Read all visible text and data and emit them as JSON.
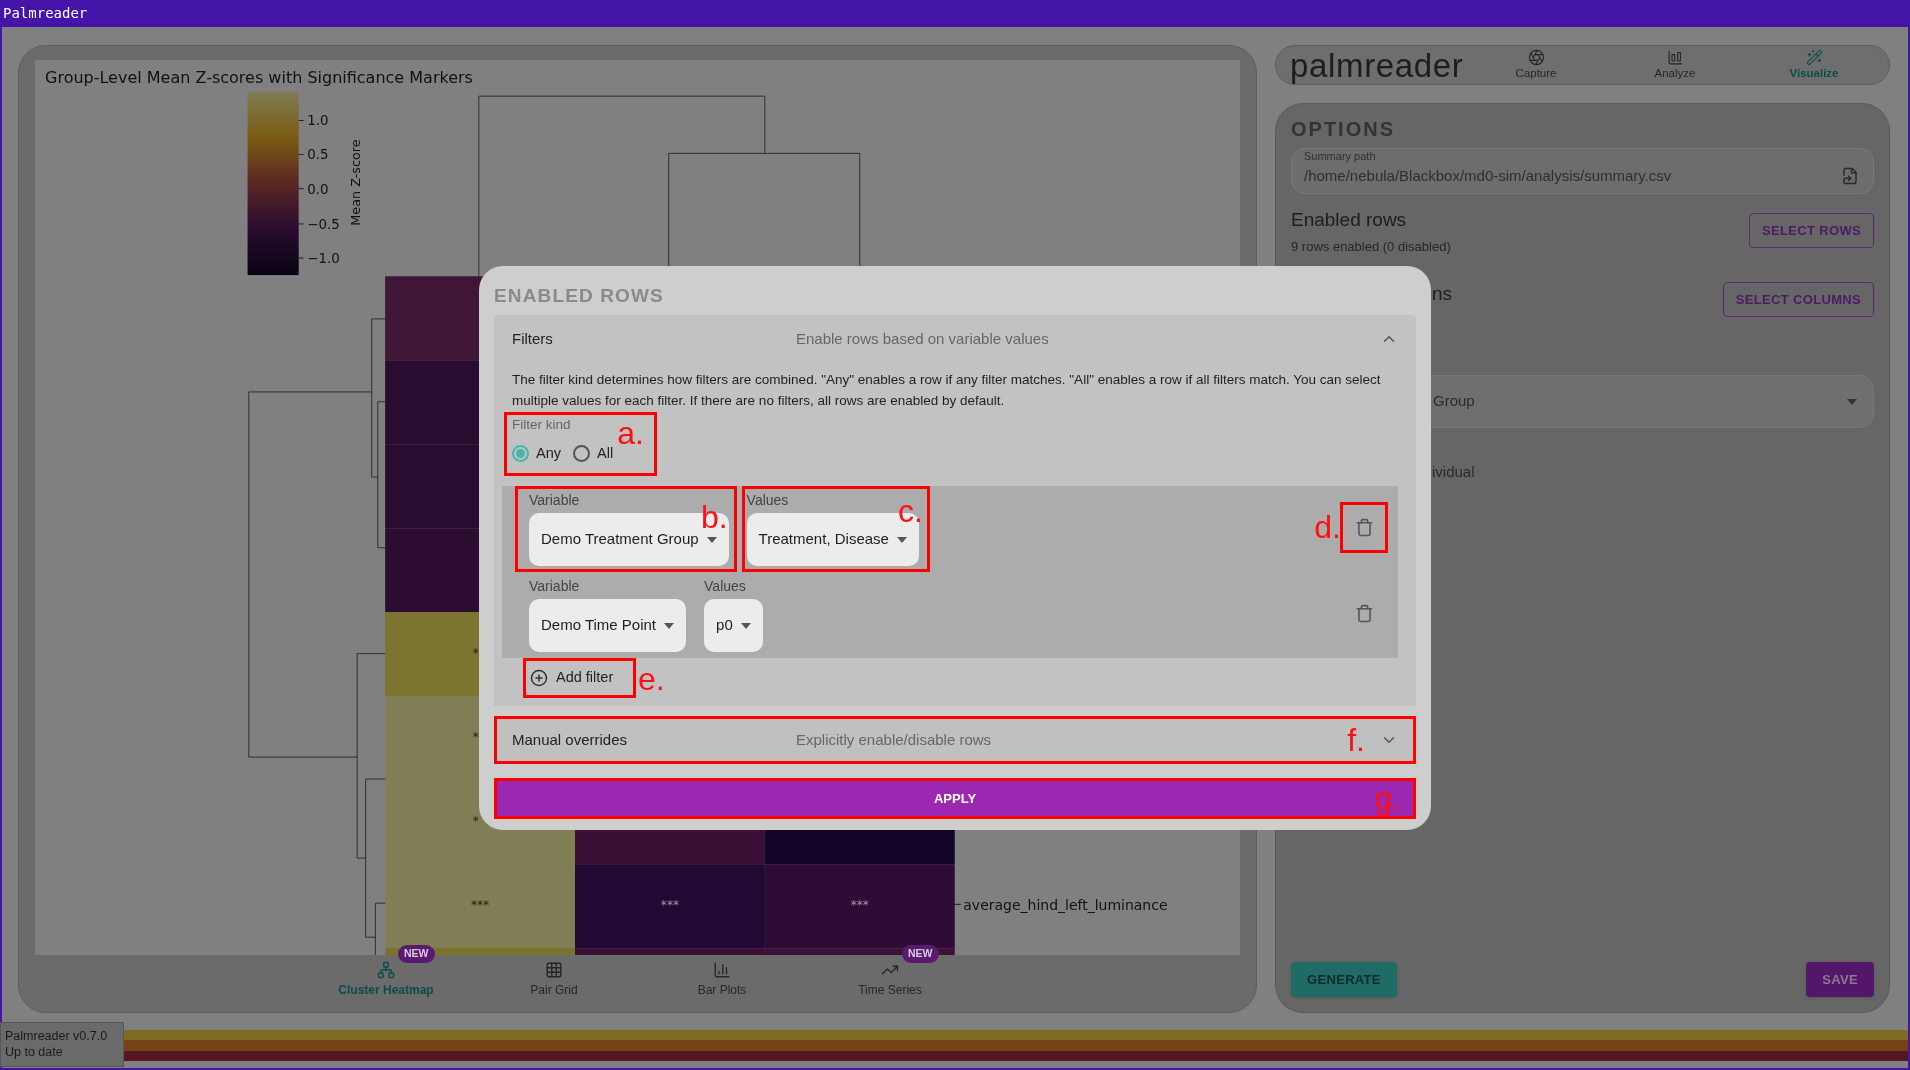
{
  "window": {
    "title": "Palmreader"
  },
  "chart": {
    "title": "Group-Level Mean Z-scores with Significance Markers",
    "colorbar": {
      "label": "Mean Z-score",
      "ticks": [
        "1.0",
        "0.5",
        "0.0",
        "−0.5",
        "−1.0"
      ]
    },
    "marked_rows": [
      {
        "marks": [
          "*"
        ]
      },
      {
        "marks": [
          "*"
        ]
      },
      {
        "marks": [
          "*"
        ]
      },
      {
        "marks": [
          "***",
          "***",
          "***"
        ]
      }
    ],
    "row_label": "average_hind_left_luminance"
  },
  "bottom_tabs": [
    {
      "label": "Cluster Heatmap",
      "selected": true,
      "badge": "NEW"
    },
    {
      "label": "Pair Grid",
      "selected": false
    },
    {
      "label": "Bar Plots",
      "selected": false
    },
    {
      "label": "Time Series",
      "selected": false,
      "badge": "NEW"
    }
  ],
  "header": {
    "logo": "palmreader",
    "tabs": [
      {
        "label": "Capture",
        "selected": false
      },
      {
        "label": "Analyze",
        "selected": false
      },
      {
        "label": "Visualize",
        "selected": true
      }
    ]
  },
  "options": {
    "title": "OPTIONS",
    "summary_path": {
      "label": "Summary path",
      "value": "/home/nebula/Blackbox/md0-sim/analysis/summary.csv"
    },
    "enabled_rows": {
      "title": "Enabled rows",
      "summary": "9 rows enabled (0 disabled)",
      "button": "SELECT ROWS"
    },
    "enabled_columns": {
      "title": "ns",
      "button": "SELECT COLUMNS"
    },
    "group_select": {
      "value": "Group"
    },
    "partial_text": "ividual",
    "generate_button": "GENERATE",
    "save_button": "SAVE"
  },
  "status": {
    "version": "Palmreader v0.7.0",
    "update": "Up to date"
  },
  "dialog": {
    "title": "ENABLED ROWS",
    "filters": {
      "title": "Filters",
      "subtitle": "Enable rows based on variable values",
      "expanded": true,
      "description": "The filter kind determines how filters are combined. \"Any\" enables a row if any filter matches. \"All\" enables a row if all filters match. You can select multiple values for each filter. If there are no filters, all rows are enabled by default.",
      "filter_kind": {
        "label": "Filter kind",
        "note": "a.",
        "options": [
          {
            "label": "Any",
            "selected": true
          },
          {
            "label": "All",
            "selected": false
          }
        ]
      },
      "rows": [
        {
          "variable_label": "Variable",
          "variable": "Demo Treatment Group",
          "values_label": "Values",
          "values": "Treatment, Disease",
          "variable_note": "b.",
          "values_note": "c.",
          "delete_note": "d."
        },
        {
          "variable_label": "Variable",
          "variable": "Demo Time Point",
          "values_label": "Values",
          "values": "p0"
        }
      ],
      "add_button": {
        "label": "Add filter",
        "note": "e."
      }
    },
    "manual_overrides": {
      "title": "Manual overrides",
      "subtitle": "Explicitly enable/disable rows",
      "expanded": false,
      "note": "f."
    },
    "apply_button": {
      "label": "APPLY",
      "note": "g."
    }
  }
}
